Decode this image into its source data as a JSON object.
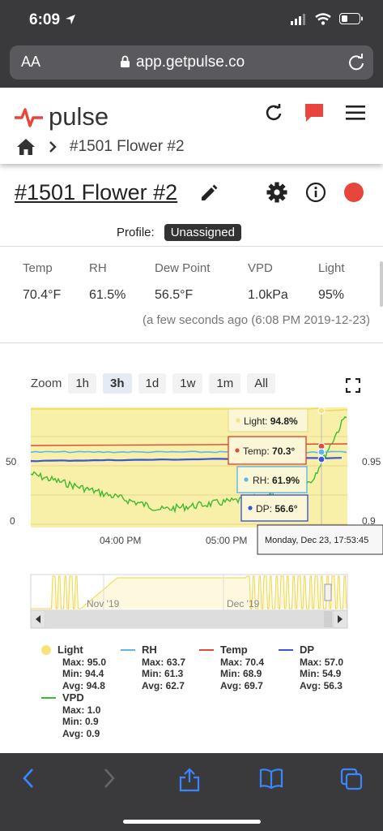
{
  "status_bar": {
    "time": "6:09"
  },
  "browser": {
    "aa_label": "AA",
    "url": "app.getpulse.co"
  },
  "header": {
    "brand": "pulse"
  },
  "breadcrumb": {
    "current": "#1501 Flower #2"
  },
  "device": {
    "title": "#1501 Flower #2",
    "profile_label": "Profile:",
    "profile_value": "Unassigned"
  },
  "readings": [
    {
      "label": "Temp",
      "value": "70.4°F"
    },
    {
      "label": "RH",
      "value": "61.5%"
    },
    {
      "label": "Dew Point",
      "value": "56.5°F"
    },
    {
      "label": "VPD",
      "value": "1.0kPa"
    },
    {
      "label": "Light",
      "value": "95%"
    }
  ],
  "timestamp": "(a few seconds ago (6:08 PM 2019-12-23)",
  "zoom": {
    "label": "Zoom",
    "options": [
      "1h",
      "3h",
      "1d",
      "1w",
      "1m",
      "All"
    ],
    "active": "3h"
  },
  "colors": {
    "light": "#f7e37a",
    "rh": "#5bb8e8",
    "temp": "#e04a3a",
    "dp": "#3a55d6",
    "vpd": "#3dbb2e",
    "plot_bg": "#f8f0a8"
  },
  "chart_data": {
    "type": "line",
    "x_tick_labels": [
      "04:00 PM",
      "05:00 PM"
    ],
    "y_left_ticks": [
      "50",
      "0"
    ],
    "y_right_ticks": [
      "0.95",
      "0.9"
    ],
    "series": [
      {
        "name": "Light",
        "legend": {
          "max": "95.0",
          "min": "94.4",
          "avg": "94.8"
        }
      },
      {
        "name": "RH",
        "legend": {
          "max": "63.7",
          "min": "61.3",
          "avg": "62.7"
        }
      },
      {
        "name": "Temp",
        "legend": {
          "max": "70.4",
          "min": "68.9",
          "avg": "69.7"
        }
      },
      {
        "name": "DP",
        "legend": {
          "max": "57.0",
          "min": "54.9",
          "avg": "56.3"
        }
      },
      {
        "name": "VPD",
        "legend": {
          "max": "1.0",
          "min": "0.9",
          "avg": "0.9"
        }
      }
    ],
    "tooltips": [
      {
        "label": "Light:",
        "value": "94.8%"
      },
      {
        "label": "Temp:",
        "value": "70.3°"
      },
      {
        "label": "RH:",
        "value": "61.9%"
      },
      {
        "label": "DP:",
        "value": "56.6°"
      }
    ],
    "hover_time": "Monday, Dec 23, 17:53:45",
    "navigator_labels": [
      "Nov '19",
      "Dec '19"
    ]
  },
  "legend_labels": {
    "max": "Max:",
    "min": "Min:",
    "avg": "Avg:"
  }
}
